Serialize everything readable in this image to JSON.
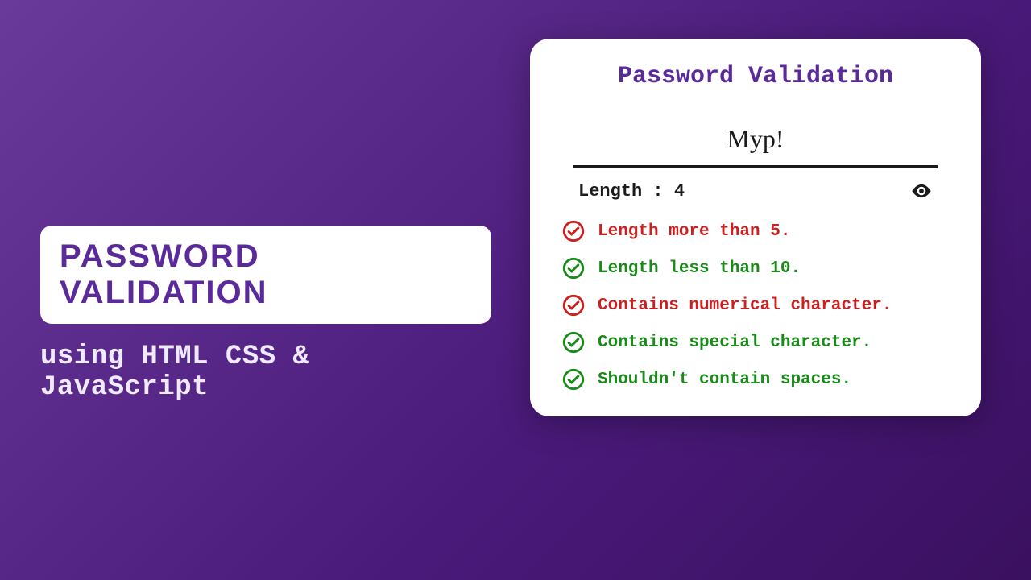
{
  "left": {
    "title": "PASSWORD VALIDATION",
    "subtitle": "using HTML CSS & JavaScript"
  },
  "card": {
    "title": "Password Validation",
    "input_value": "Myp!",
    "length_label": "Length : 4",
    "rules": [
      {
        "text": "Length more than 5.",
        "status": "fail"
      },
      {
        "text": "Length less than 10.",
        "status": "pass"
      },
      {
        "text": "Contains numerical character.",
        "status": "fail"
      },
      {
        "text": "Contains special character.",
        "status": "pass"
      },
      {
        "text": "Shouldn't contain spaces.",
        "status": "pass"
      }
    ]
  },
  "colors": {
    "accent": "#5a2a9a",
    "pass": "#1a8a1a",
    "fail": "#cc1f1f"
  }
}
